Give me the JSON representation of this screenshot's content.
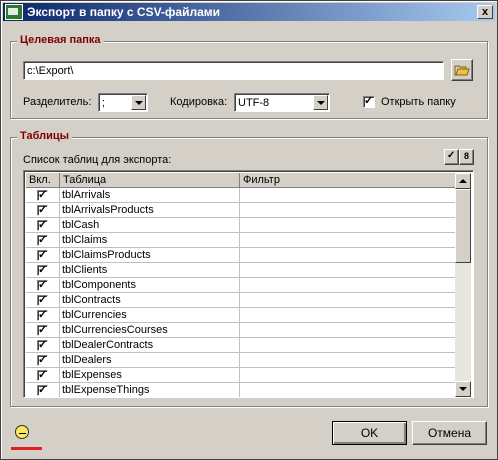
{
  "window": {
    "title": "Экспорт в папку с CSV-файлами",
    "app_icon": "csv-app-icon",
    "close_glyph": "x"
  },
  "target_folder": {
    "group_title": "Целевая папка",
    "path_value": "c:\\Export\\",
    "browse_icon": "folder-open-icon",
    "separator_label": "Разделитель:",
    "separator_value": ";",
    "encoding_label": "Кодировка:",
    "encoding_value": "UTF-8",
    "open_folder_label": "Открыть папку",
    "open_folder_checked": true
  },
  "tables": {
    "group_title": "Таблицы",
    "list_label": "Список таблиц для экспорта:",
    "columns": [
      "Вкл.",
      "Таблица",
      "Фильтр"
    ],
    "rows": [
      {
        "checked": true,
        "name": "tblArrivals",
        "filter": ""
      },
      {
        "checked": true,
        "name": "tblArrivalsProducts",
        "filter": ""
      },
      {
        "checked": true,
        "name": "tblCash",
        "filter": ""
      },
      {
        "checked": true,
        "name": "tblClaims",
        "filter": ""
      },
      {
        "checked": true,
        "name": "tblClaimsProducts",
        "filter": ""
      },
      {
        "checked": true,
        "name": "tblClients",
        "filter": ""
      },
      {
        "checked": true,
        "name": "tblComponents",
        "filter": ""
      },
      {
        "checked": true,
        "name": "tblContracts",
        "filter": ""
      },
      {
        "checked": true,
        "name": "tblCurrencies",
        "filter": ""
      },
      {
        "checked": true,
        "name": "tblCurrenciesCourses",
        "filter": ""
      },
      {
        "checked": true,
        "name": "tblDealerContracts",
        "filter": ""
      },
      {
        "checked": true,
        "name": "tblDealers",
        "filter": ""
      },
      {
        "checked": true,
        "name": "tblExpenses",
        "filter": ""
      },
      {
        "checked": true,
        "name": "tblExpenseThings",
        "filter": ""
      }
    ]
  },
  "footer": {
    "ok_label": "OK",
    "cancel_label": "Отмена",
    "status_icon": "gauge-icon",
    "accent_color": "#e02020"
  }
}
